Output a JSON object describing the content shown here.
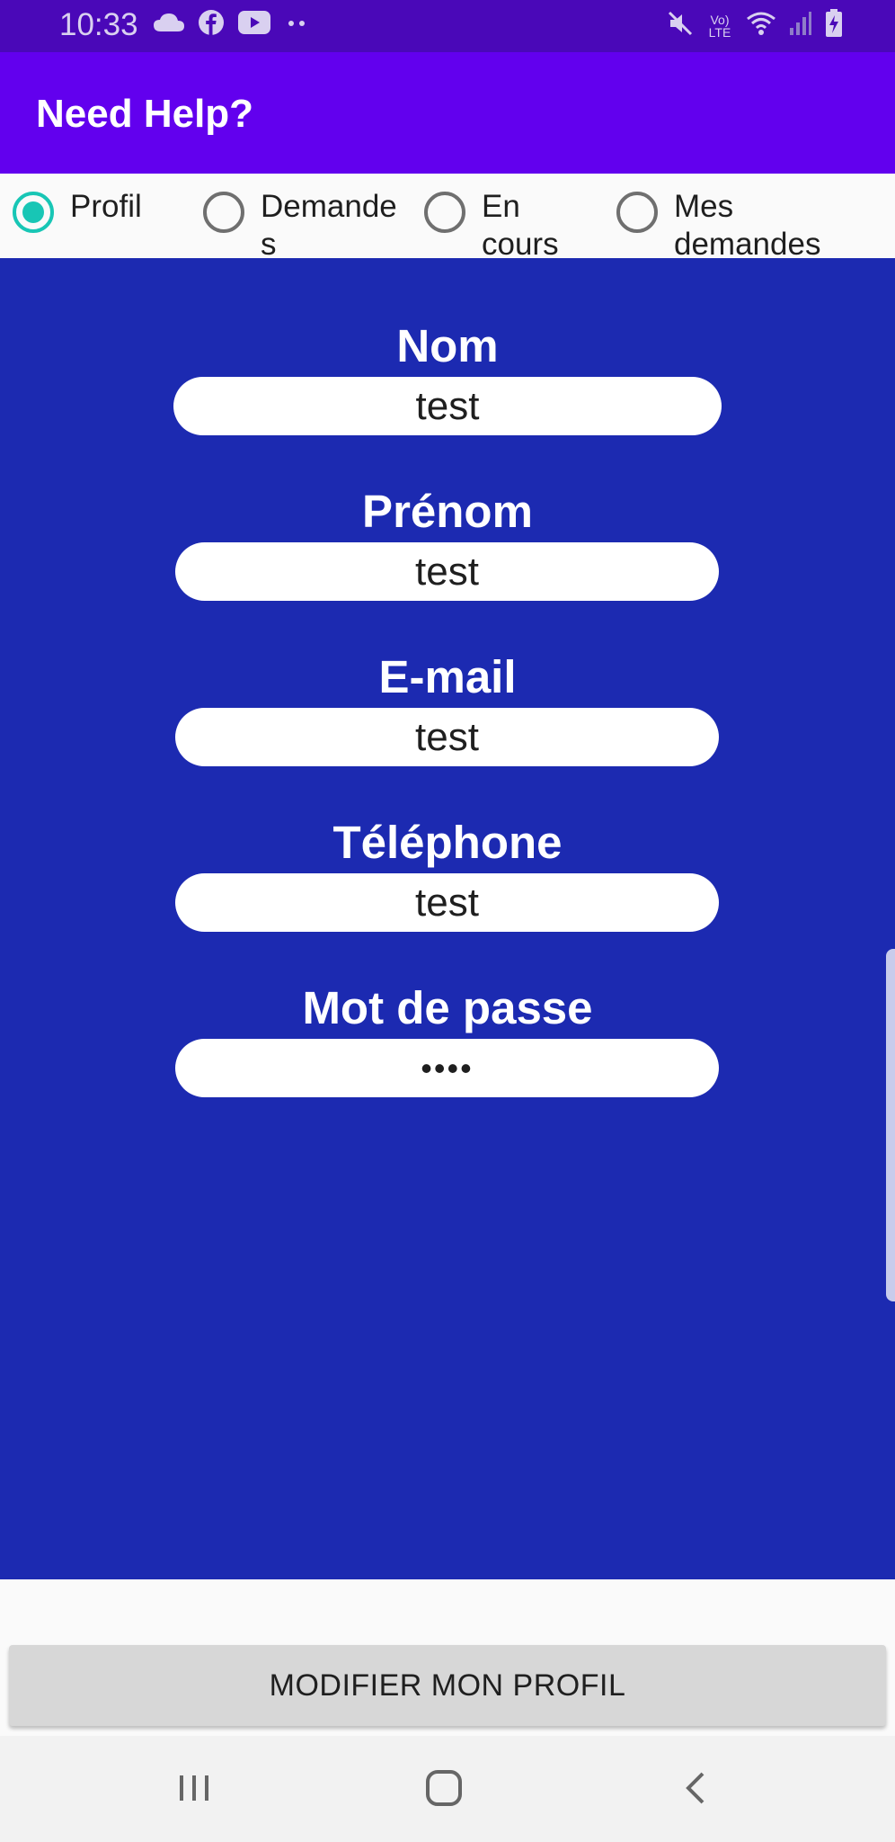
{
  "status_bar": {
    "time": "10:33",
    "left_icons": [
      "cloud-icon",
      "facebook-icon",
      "youtube-icon",
      "more-dots-icon"
    ],
    "right_icons": [
      "mute-icon",
      "volte-icon",
      "wifi-icon",
      "signal-icon",
      "battery-charging-icon"
    ],
    "volte_label": "Vo) LTE"
  },
  "app_bar": {
    "title": "Need Help?"
  },
  "tabs": [
    {
      "label": "Profil",
      "checked": true
    },
    {
      "label": "Demandes",
      "checked": false
    },
    {
      "label": "En cours",
      "checked": false
    },
    {
      "label": "Mes demandes",
      "checked": false
    }
  ],
  "form": {
    "fields": [
      {
        "label": "Nom",
        "value": "test"
      },
      {
        "label": "Prénom",
        "value": "test"
      },
      {
        "label": "E-mail",
        "value": "test"
      },
      {
        "label": "Téléphone",
        "value": "test"
      },
      {
        "label": "Mot de passe",
        "value": "••••"
      }
    ]
  },
  "actions": {
    "modify_profile_label": "MODIFIER MON PROFIL"
  },
  "nav_bar": {
    "items": [
      "recent-apps-icon",
      "home-icon",
      "back-icon"
    ]
  },
  "colors": {
    "status_bar": "#4a08b8",
    "app_bar": "#6200ee",
    "form_background": "#1c2ab1",
    "radio_checked": "#18c6b5",
    "button": "#d7d7d7"
  }
}
